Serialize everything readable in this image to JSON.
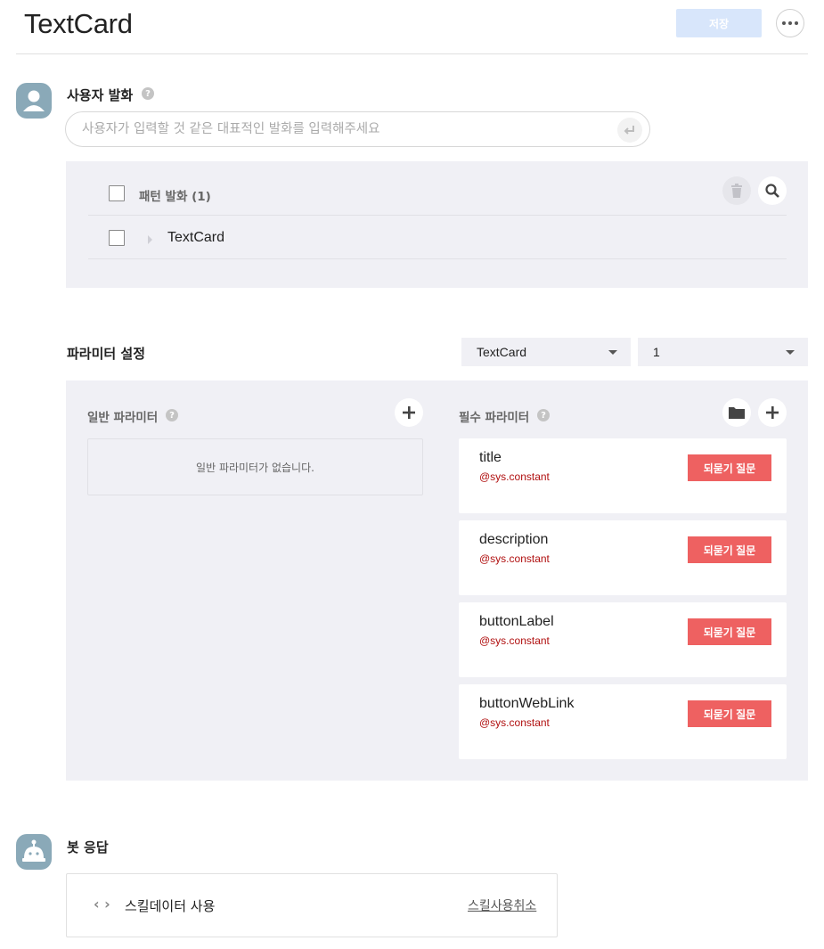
{
  "header": {
    "title": "TextCard",
    "save_label": "저장",
    "more_icon": "more-horizontal-icon"
  },
  "user_utterance": {
    "label": "사용자 발화",
    "input": {
      "placeholder": "사용자가 입력할 것 같은 대표적인 발화를 입력해주세요",
      "value": ""
    },
    "pattern_header": "패턴 발화 (1)",
    "patterns": [
      {
        "text": "TextCard"
      }
    ]
  },
  "parameters": {
    "label": "파라미터 설정",
    "select_one": {
      "value": "TextCard"
    },
    "select_two": {
      "value": "1"
    },
    "general": {
      "label": "일반 파라미터",
      "empty_text": "일반 파라미터가 없습니다."
    },
    "required": {
      "label": "필수 파라미터",
      "items": [
        {
          "name": "title",
          "entity": "@sys.constant",
          "button": "되묻기 질문"
        },
        {
          "name": "description",
          "entity": "@sys.constant",
          "button": "되묻기 질문"
        },
        {
          "name": "buttonLabel",
          "entity": "@sys.constant",
          "button": "되묻기 질문"
        },
        {
          "name": "buttonWebLink",
          "entity": "@sys.constant",
          "button": "되묻기 질문"
        }
      ]
    }
  },
  "bot_response": {
    "label": "봇 응답",
    "skill_data_label": "스킬데이터 사용",
    "skill_cancel_label": "스킬사용취소"
  },
  "colors": {
    "accent_disabled": "#d8e6fb",
    "panel_bg": "#f0f0f5",
    "reprompt_button": "#ee6161",
    "entity_text": "#b00f0f",
    "avatar_bg": "#8aa9b8"
  }
}
